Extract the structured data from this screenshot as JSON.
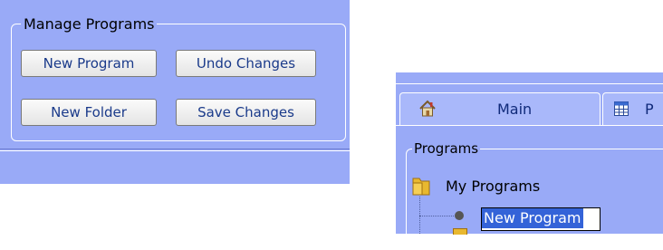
{
  "manage": {
    "legend": "Manage Programs",
    "new_program": "New Program",
    "undo_changes": "Undo Changes",
    "new_folder": "New Folder",
    "save_changes": "Save Changes"
  },
  "tabs": {
    "main": "Main",
    "second_partial": "P"
  },
  "programs": {
    "legend": "Programs",
    "root_label": "My Programs",
    "editing_value": "New Program"
  },
  "icons": {
    "home": "home-icon",
    "grid": "grid-icon",
    "folder": "folder-icon"
  }
}
